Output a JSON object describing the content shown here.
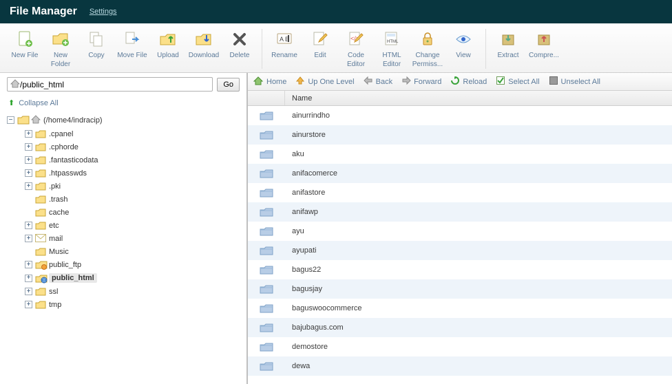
{
  "header": {
    "title": "File Manager",
    "settings": "Settings"
  },
  "toolbar": [
    {
      "key": "new-file",
      "label": "New File"
    },
    {
      "key": "new-folder",
      "label": "New Folder"
    },
    {
      "key": "copy",
      "label": "Copy"
    },
    {
      "key": "move-file",
      "label": "Move File"
    },
    {
      "key": "upload",
      "label": "Upload"
    },
    {
      "key": "download",
      "label": "Download"
    },
    {
      "key": "delete",
      "label": "Delete"
    },
    {
      "divider": true
    },
    {
      "key": "rename",
      "label": "Rename"
    },
    {
      "key": "edit",
      "label": "Edit"
    },
    {
      "key": "code-editor",
      "label": "Code Editor"
    },
    {
      "key": "html-editor",
      "label": "HTML Editor"
    },
    {
      "key": "change-permissions",
      "label": "Change Permiss..."
    },
    {
      "key": "view",
      "label": "View"
    },
    {
      "divider": true
    },
    {
      "key": "extract",
      "label": "Extract"
    },
    {
      "key": "compress",
      "label": "Compre..."
    }
  ],
  "sidebar": {
    "path_value": "/public_html",
    "go_label": "Go",
    "collapse_label": "Collapse All",
    "root_label": "(/home4/indracip)",
    "tree": [
      {
        "label": ".cpanel",
        "expandable": true,
        "icon": "folder"
      },
      {
        "label": ".cphorde",
        "expandable": true,
        "icon": "folder"
      },
      {
        "label": ".fantasticodata",
        "expandable": true,
        "icon": "folder"
      },
      {
        "label": ".htpasswds",
        "expandable": true,
        "icon": "folder"
      },
      {
        "label": ".pki",
        "expandable": true,
        "icon": "folder"
      },
      {
        "label": ".trash",
        "expandable": false,
        "icon": "folder"
      },
      {
        "label": "cache",
        "expandable": false,
        "icon": "folder"
      },
      {
        "label": "etc",
        "expandable": true,
        "icon": "folder"
      },
      {
        "label": "mail",
        "expandable": true,
        "icon": "mail"
      },
      {
        "label": "Music",
        "expandable": false,
        "icon": "folder"
      },
      {
        "label": "public_ftp",
        "expandable": true,
        "icon": "folder-badge"
      },
      {
        "label": "public_html",
        "expandable": true,
        "icon": "folder-globe",
        "selected": true
      },
      {
        "label": "ssl",
        "expandable": true,
        "icon": "folder"
      },
      {
        "label": "tmp",
        "expandable": true,
        "icon": "folder"
      }
    ]
  },
  "navbar": {
    "home": "Home",
    "up": "Up One Level",
    "back": "Back",
    "forward": "Forward",
    "reload": "Reload",
    "select_all": "Select All",
    "unselect_all": "Unselect All"
  },
  "grid": {
    "header_name": "Name",
    "rows": [
      "ainurrindho",
      "ainurstore",
      "aku",
      "anifacomerce",
      "anifastore",
      "anifawp",
      "ayu",
      "ayupati",
      "bagus22",
      "bagusjay",
      "baguswoocommerce",
      "bajubagus.com",
      "demostore",
      "dewa"
    ]
  }
}
